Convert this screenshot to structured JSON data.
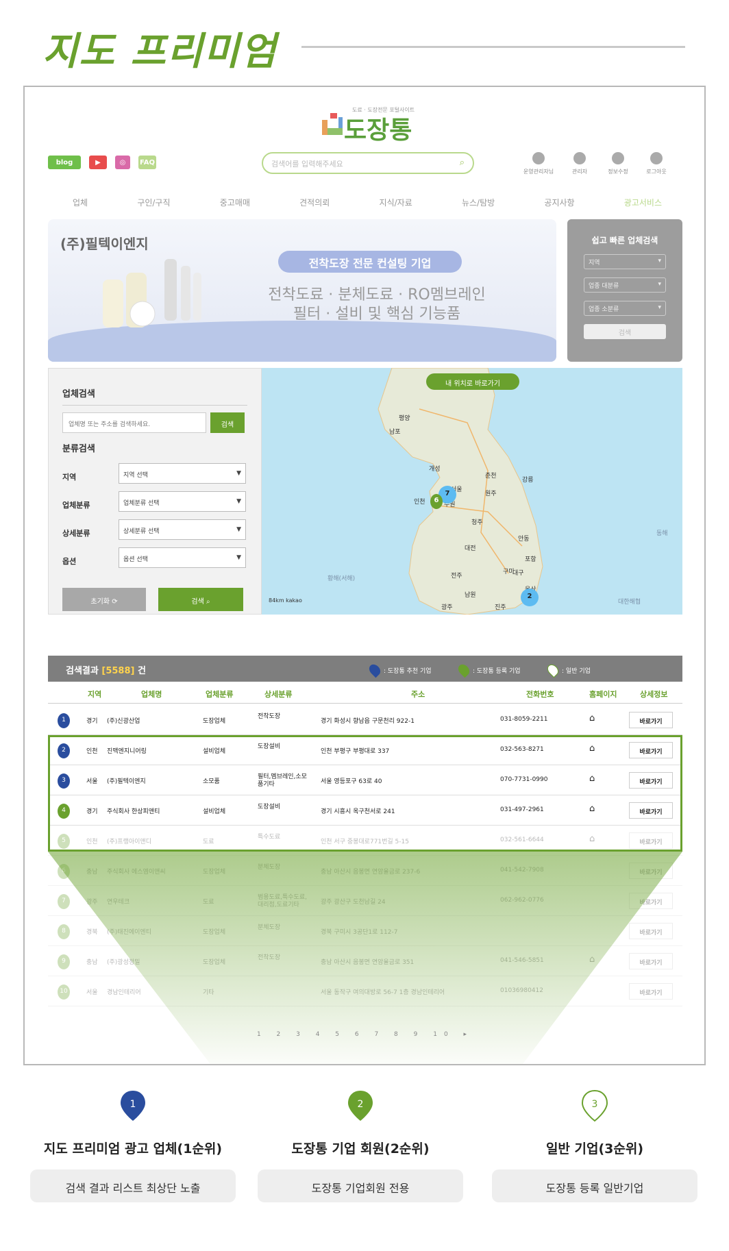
{
  "header": {
    "title": "지도 프리미엄"
  },
  "site": {
    "logo_sub": "도료 · 도장전문 포털사이트",
    "logo_text": "도장통",
    "sns": [
      "blog",
      "▶",
      "◎",
      "FAQ"
    ],
    "search_placeholder": "검색어를 입력해주세요",
    "account": [
      "운영관리자님",
      "관리자",
      "정보수정",
      "로그아웃"
    ],
    "nav": [
      "업체",
      "구인/구직",
      "중고매매",
      "견적의뢰",
      "지식/자료",
      "뉴스/탐방",
      "공지사항",
      "광고서비스"
    ]
  },
  "banner": {
    "company": "(주)필텍이엔지",
    "badge": "전착도장 전문 컨설팅 기업",
    "line1": "전착도료 · 분체도료 · RO멤브레인",
    "line2": "필터 · 설비 및 핵심 기능품"
  },
  "quick_search": {
    "title": "쉽고 빠른 업체검색",
    "selects": [
      "지역",
      "업종 대분류",
      "업종 소분류"
    ],
    "button": "검색"
  },
  "search_panel": {
    "title": "업체검색",
    "input_placeholder": "업체명 또는 주소를 검색하세요.",
    "search_button": "검색",
    "category_title": "분류검색",
    "filters": [
      {
        "label": "지역",
        "value": "지역 선택"
      },
      {
        "label": "업체분류",
        "value": "업체분류 선택"
      },
      {
        "label": "상세분류",
        "value": "상세분류 선택"
      },
      {
        "label": "옵션",
        "value": "옵션 선택"
      }
    ],
    "reset_button": "초기화",
    "submit_button": "검색"
  },
  "map": {
    "my_location": "내 위치로 바로가기",
    "scale": "84km  kakao",
    "clusters": [
      "7",
      "6",
      "2"
    ],
    "cities": [
      "평양",
      "남포",
      "개성",
      "서울",
      "인천",
      "수원",
      "대전",
      "대구",
      "울산",
      "광주",
      "춘천",
      "강릉",
      "포항",
      "원주",
      "청주",
      "안동",
      "전주",
      "구미",
      "남원",
      "진주"
    ],
    "seas": [
      "황해(서해)",
      "동해",
      "대한해협"
    ]
  },
  "results": {
    "label": "검색결과",
    "count": "[5588]",
    "unit": "건",
    "legend": [
      ": 도장통 추천 기업",
      ": 도장통 등록 기업",
      ": 일반 기업"
    ],
    "legend_colors": [
      "#2a4d9e",
      "#6aa12e",
      "#ffffff"
    ],
    "columns": [
      "지역",
      "업체명",
      "업체분류",
      "상세분류",
      "주소",
      "전화번호",
      "홈페이지",
      "상세정보"
    ],
    "rows": [
      {
        "n": "1",
        "region": "경기",
        "name": "(주)신광산업",
        "cat": "도장업체",
        "sub": "전착도장",
        "addr": "경기 화성시 향남읍 구문천리 922-1",
        "tel": "031-8059-2211",
        "home": "⌂",
        "btn": "바로가기"
      },
      {
        "n": "2",
        "region": "인천",
        "name": "진맥엔지니어링",
        "cat": "설비업체",
        "sub": "도장설비",
        "addr": "인천 부평구 부평대로 337",
        "tel": "032-563-8271",
        "home": "⌂",
        "btn": "바로가기"
      },
      {
        "n": "3",
        "region": "서울",
        "name": "(주)필텍이엔지",
        "cat": "소모품",
        "sub": "필터,멤브레인,소모품기타",
        "addr": "서울 영등포구 63로 40",
        "tel": "070-7731-0990",
        "home": "⌂",
        "btn": "바로가기"
      },
      {
        "n": "4",
        "region": "경기",
        "name": "주식회사 한상피앤티",
        "cat": "설비업체",
        "sub": "도장설비",
        "addr": "경기 시흥시 옥구천서로 241",
        "tel": "031-497-2961",
        "home": "⌂",
        "btn": "바로가기"
      },
      {
        "n": "5",
        "region": "인천",
        "name": "(주)프랭아이앤디",
        "cat": "도료",
        "sub": "특수도료",
        "addr": "인천 서구 중봉대로771번길 5-15",
        "tel": "032-561-6644",
        "home": "⌂",
        "btn": "바로가기"
      },
      {
        "n": "6",
        "region": "충남",
        "name": "주식회사 에스엠이앤씨",
        "cat": "도장업체",
        "sub": "분체도장",
        "addr": "충남 아산시 음봉면 연암율금로 237-6",
        "tel": "041-542-7908",
        "home": "",
        "btn": "바로가기"
      },
      {
        "n": "7",
        "region": "광주",
        "name": "연우테크",
        "cat": "도료",
        "sub": "범용도료,특수도료,대리점,도료기타",
        "addr": "광주 광산구 도천남길 24",
        "tel": "062-962-0776",
        "home": "",
        "btn": "바로가기"
      },
      {
        "n": "8",
        "region": "경북",
        "name": "(주)태진에이엔티",
        "cat": "도장업체",
        "sub": "분체도장",
        "addr": "경북 구미시 3공단1로 112-7",
        "tel": "",
        "home": "",
        "btn": "바로가기"
      },
      {
        "n": "9",
        "region": "충남",
        "name": "(주)광성정밀",
        "cat": "도장업체",
        "sub": "전착도장",
        "addr": "충남 아산시 음봉면 연암율금로 351",
        "tel": "041-546-5851",
        "home": "⌂",
        "btn": "바로가기"
      },
      {
        "n": "10",
        "region": "서울",
        "name": "경남인테리어",
        "cat": "기타",
        "sub": "",
        "addr": "서울 동작구 여의대방로 56-7 1층 경남인테리어",
        "tel": "01036980412",
        "home": "",
        "btn": "바로가기"
      }
    ],
    "pages": "1 2 3 4 5 6 7 8 9 10 ▸"
  },
  "features": [
    {
      "num": "1",
      "title": "지도 프리미엄 광고 업체(1순위)",
      "desc": "검색 결과 리스트 최상단 노출",
      "color": "#2a4d9e"
    },
    {
      "num": "2",
      "title": "도장통 기업 회원(2순위)",
      "desc": "도장통 기업회원 전용",
      "color": "#6aa12e"
    },
    {
      "num": "3",
      "title": "일반 기업(3순위)",
      "desc": "도장통 등록 일반기업",
      "color": "#ffffff"
    }
  ]
}
